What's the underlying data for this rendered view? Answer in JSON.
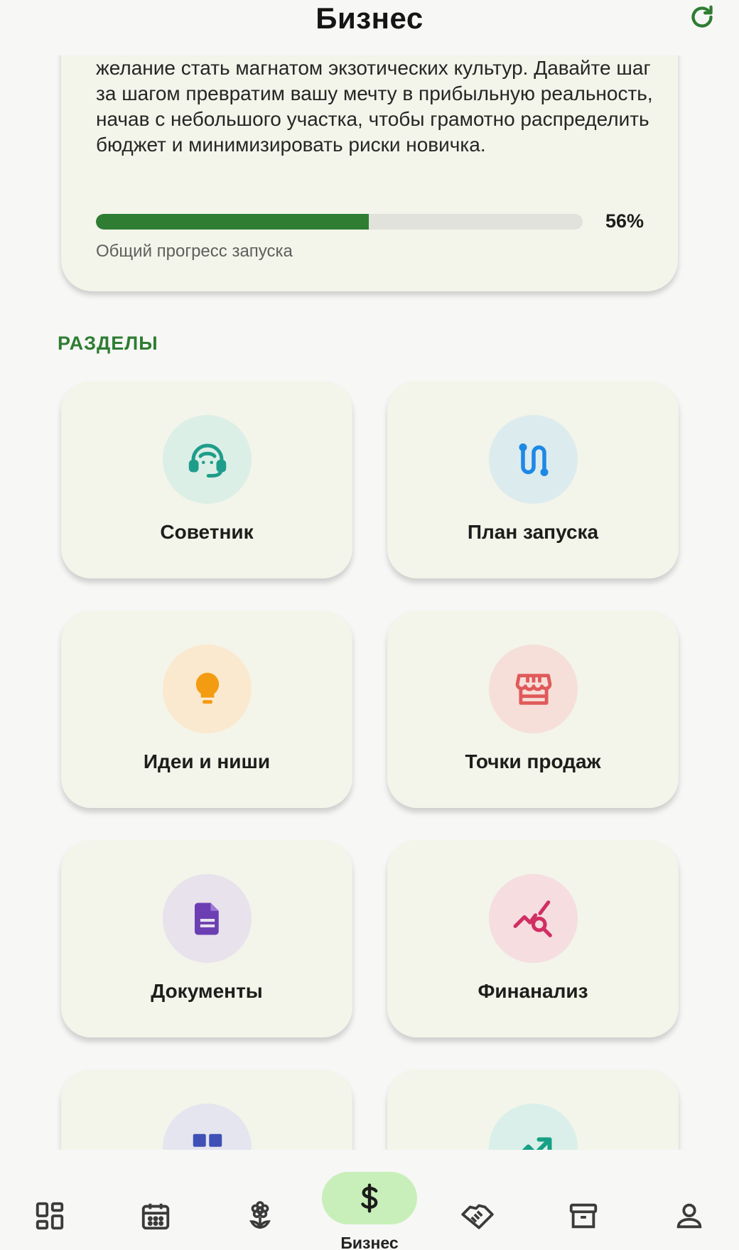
{
  "header": {
    "title": "Бизнес",
    "refresh_icon": "refresh-icon"
  },
  "intro": {
    "text": "желание стать магнатом экзотических культур. Давайте шаг за шагом превратим вашу мечту в прибыльную реальность, начав с небольшого участка, чтобы грамотно распределить бюджет и минимизировать риски новичка.",
    "progress_fraction": 0.56,
    "progress_text": "56%",
    "progress_label": "Общий прогресс запуска"
  },
  "sections": {
    "title": "РАЗДЕЛЫ",
    "tiles": [
      {
        "label": "Советник",
        "icon": "headset-icon",
        "circle_color": "#dcefe6",
        "icon_color": "#1f9d8b"
      },
      {
        "label": "План запуска",
        "icon": "route-icon",
        "circle_color": "#dcebee",
        "icon_color": "#1e88e5"
      },
      {
        "label": "Идеи и ниши",
        "icon": "lightbulb-icon",
        "circle_color": "#fbe9cf",
        "icon_color": "#f39c12"
      },
      {
        "label": "Точки продаж",
        "icon": "storefront-icon",
        "circle_color": "#f6dfd9",
        "icon_color": "#e05a5a"
      },
      {
        "label": "Документы",
        "icon": "document-icon",
        "circle_color": "#e8e2ec",
        "icon_color": "#6b3fb3"
      },
      {
        "label": "Финанализ",
        "icon": "query-stats-icon",
        "circle_color": "#f5dde0",
        "icon_color": "#d12e64"
      },
      {
        "label": "",
        "icon": "dashboard-icon",
        "circle_color": "#e4e5ee",
        "icon_color": "#3f51b5"
      },
      {
        "label": "",
        "icon": "trending-up-icon",
        "circle_color": "#daefe9",
        "icon_color": "#17a085"
      }
    ]
  },
  "bottom_nav": {
    "items": [
      {
        "icon": "dashboard-grid-icon"
      },
      {
        "icon": "calendar-icon"
      },
      {
        "icon": "flower-icon"
      },
      {
        "icon": "dollar-icon",
        "label": "Бизнес",
        "active": true
      },
      {
        "icon": "handshake-icon"
      },
      {
        "icon": "archive-icon"
      },
      {
        "icon": "person-icon"
      }
    ]
  }
}
